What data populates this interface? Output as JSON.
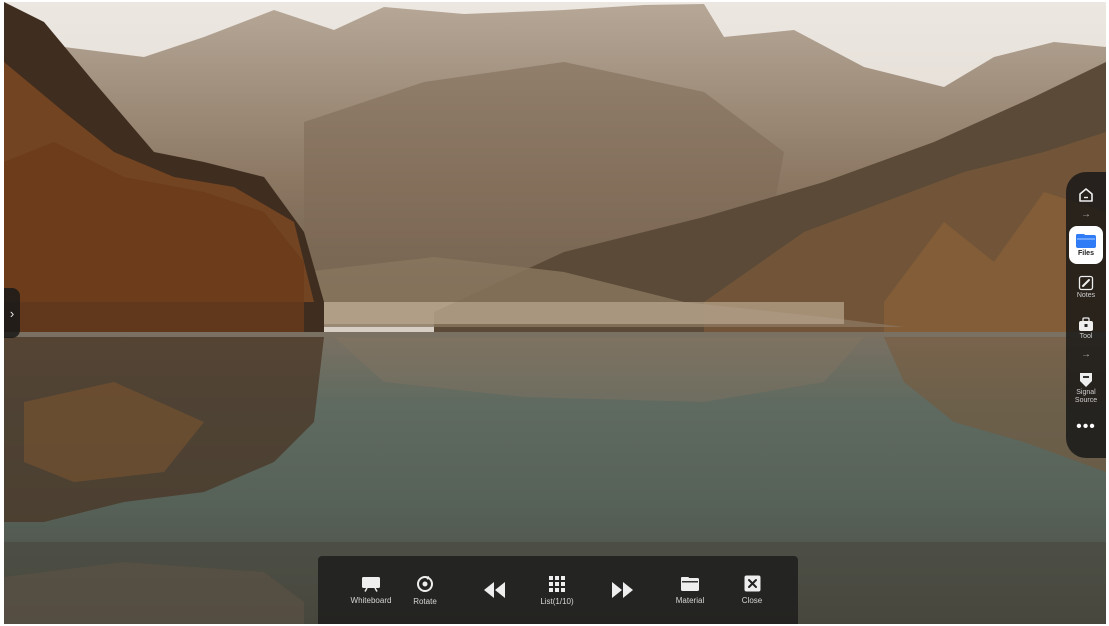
{
  "sidebar": {
    "items": [
      {
        "label": "Files",
        "icon": "folder-icon",
        "active": true
      },
      {
        "label": "Notes",
        "icon": "pen-icon",
        "active": false
      },
      {
        "label": "Tool",
        "icon": "toolbox-icon",
        "active": false
      },
      {
        "label": "Signal Source",
        "icon": "signal-source-icon",
        "active": false
      }
    ],
    "more": "•••"
  },
  "bottombar": {
    "whiteboard": "Whiteboard",
    "rotate": "Rotate",
    "list": "List(1/10)",
    "material": "Material",
    "close": "Close"
  },
  "colors": {
    "sidebar_bg": "#161616",
    "active_item_bg": "#ffffff",
    "accent_blue": "#2f7cf6"
  }
}
